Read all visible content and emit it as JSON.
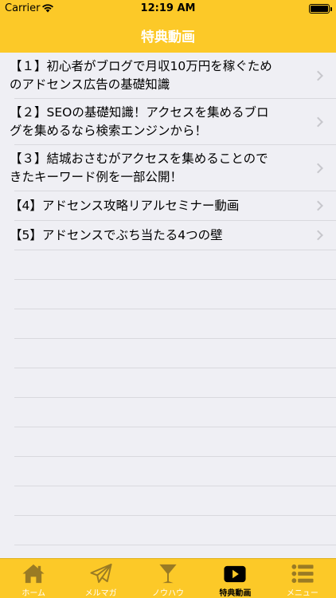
{
  "status": {
    "carrier": "Carrier",
    "time": "12:19 AM"
  },
  "nav": {
    "title": "特典動画"
  },
  "rows": [
    {
      "text": "【１】初心者がブログで月収10万円を稼ぐためのアドセンス広告の基礎知識"
    },
    {
      "text": "【２】SEOの基礎知識！アクセスを集めるブログを集めるなら検索エンジンから！"
    },
    {
      "text": "【３】結城おさむがアクセスを集めることのできたキーワード例を一部公開！"
    },
    {
      "text": "【4】アドセンス攻略リアルセミナー動画"
    },
    {
      "text": "【5】アドセンスでぶち当たる4つの壁"
    }
  ],
  "tabs": [
    {
      "label": "ホーム",
      "icon": "home-icon"
    },
    {
      "label": "メルマガ",
      "icon": "paper-plane-icon"
    },
    {
      "label": "ノウハウ",
      "icon": "cocktail-glass-icon"
    },
    {
      "label": "特典動画",
      "icon": "video-play-icon",
      "active": true
    },
    {
      "label": "メニュー",
      "icon": "menu-list-icon"
    }
  ],
  "colors": {
    "brand": "#fcc928",
    "chevron": "#c7c7cc",
    "background": "#efeff4"
  }
}
